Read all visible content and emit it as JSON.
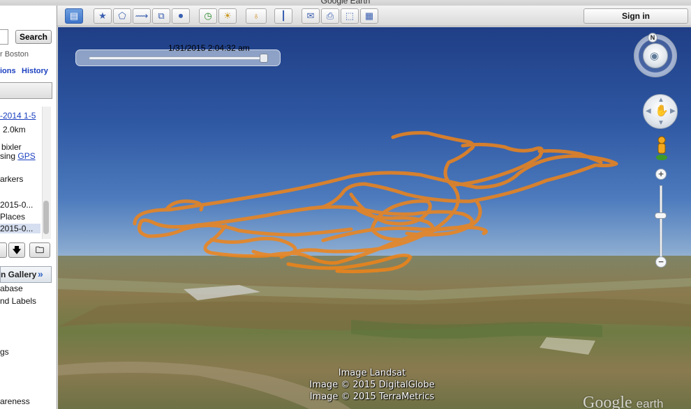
{
  "window": {
    "title": "Google Earth"
  },
  "search": {
    "button_label": "Search",
    "location_hint": "r Boston",
    "tab_directions": "ions",
    "tab_history": "History"
  },
  "places": {
    "items": [
      {
        "label": "-2014 1-5",
        "is_link": true
      },
      {
        "label": "2.0km"
      },
      {
        "label": "bixler"
      },
      {
        "label": "sing",
        "link": "GPS"
      },
      {
        "label": "arkers"
      },
      {
        "label": "2015-0..."
      },
      {
        "label": "Places"
      },
      {
        "label": "2015-0...",
        "selected": true
      }
    ]
  },
  "layers": {
    "gallery_label": "n Gallery",
    "gallery_chevron": "»",
    "items": [
      "abase",
      "nd Labels",
      "gs",
      "areness"
    ]
  },
  "toolbar": {
    "buttons": [
      {
        "name": "sidebar-toggle-icon",
        "glyph": "▤",
        "active": true
      },
      {
        "name": "add-placemark-icon",
        "glyph": "★"
      },
      {
        "name": "add-polygon-icon",
        "glyph": "⬠"
      },
      {
        "name": "add-path-icon",
        "glyph": "⟿"
      },
      {
        "name": "image-overlay-icon",
        "glyph": "⧉"
      },
      {
        "name": "record-tour-icon",
        "glyph": "⏺"
      },
      {
        "name": "historical-imagery-icon",
        "glyph": "◷"
      },
      {
        "name": "sunlight-icon",
        "glyph": "☀"
      },
      {
        "name": "planets-icon",
        "glyph": "♁"
      },
      {
        "name": "ruler-icon",
        "glyph": "┃"
      },
      {
        "name": "email-icon",
        "glyph": "✉"
      },
      {
        "name": "print-icon",
        "glyph": "⎙"
      },
      {
        "name": "save-image-icon",
        "glyph": "⬚"
      },
      {
        "name": "view-in-maps-icon",
        "glyph": "▦"
      }
    ],
    "signin_label": "Sign in"
  },
  "timeslider": {
    "timestamp": "1/31/2015    2:04:32 am",
    "position": 1.0
  },
  "navigation": {
    "north_label": "N",
    "zoom_level": 0.35
  },
  "attribution": {
    "line1": "Image Landsat",
    "line2": "Image © 2015 DigitalGlobe",
    "line3": "Image © 2015 TerraMetrics"
  },
  "wordmark": {
    "main": "Google",
    "suffix": "earth"
  },
  "colors": {
    "track": "#f08418",
    "sky_top": "#1f3e86",
    "toolbar_active": "#3d74c9"
  }
}
